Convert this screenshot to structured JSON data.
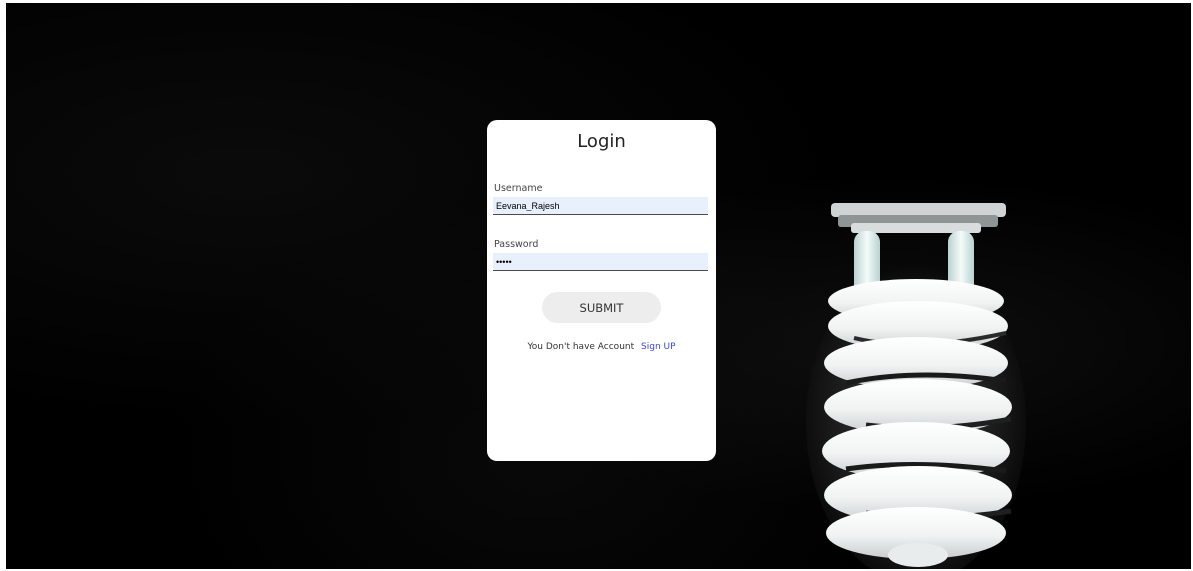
{
  "login_form": {
    "title": "Login",
    "username_label": "Username",
    "username_value": "Eevana_Rajesh",
    "password_label": "Password",
    "password_value": "•••••",
    "submit_label": "SUBMIT",
    "signup_prompt": "You Don't have Account",
    "signup_link": "Sign UP"
  },
  "colors": {
    "background": "#000000",
    "card": "#ffffff",
    "input_fill": "#e8f0fe",
    "button_fill": "#ededed",
    "link": "#3b47d6"
  },
  "background_image": {
    "icon": "cfl-light-bulb-icon"
  }
}
